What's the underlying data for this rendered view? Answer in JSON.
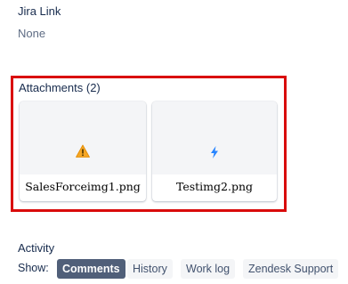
{
  "jira_link": {
    "label": "Jira Link",
    "value": "None"
  },
  "attachments": {
    "title": "Attachments (2)",
    "items": [
      {
        "filename": "SalesForceimg1.png",
        "icon": "warning-icon"
      },
      {
        "filename": "Testimg2.png",
        "icon": "lightning-icon"
      }
    ]
  },
  "activity": {
    "title": "Activity",
    "show_label": "Show:",
    "filters": [
      "Comments",
      "History",
      "Work log",
      "Zendesk Support"
    ],
    "active_filter": "Comments"
  },
  "colors": {
    "highlight_border": "#d90b0b",
    "active_filter_bg": "#505f79",
    "warning": "#f5a623",
    "lightning": "#2684ff"
  }
}
